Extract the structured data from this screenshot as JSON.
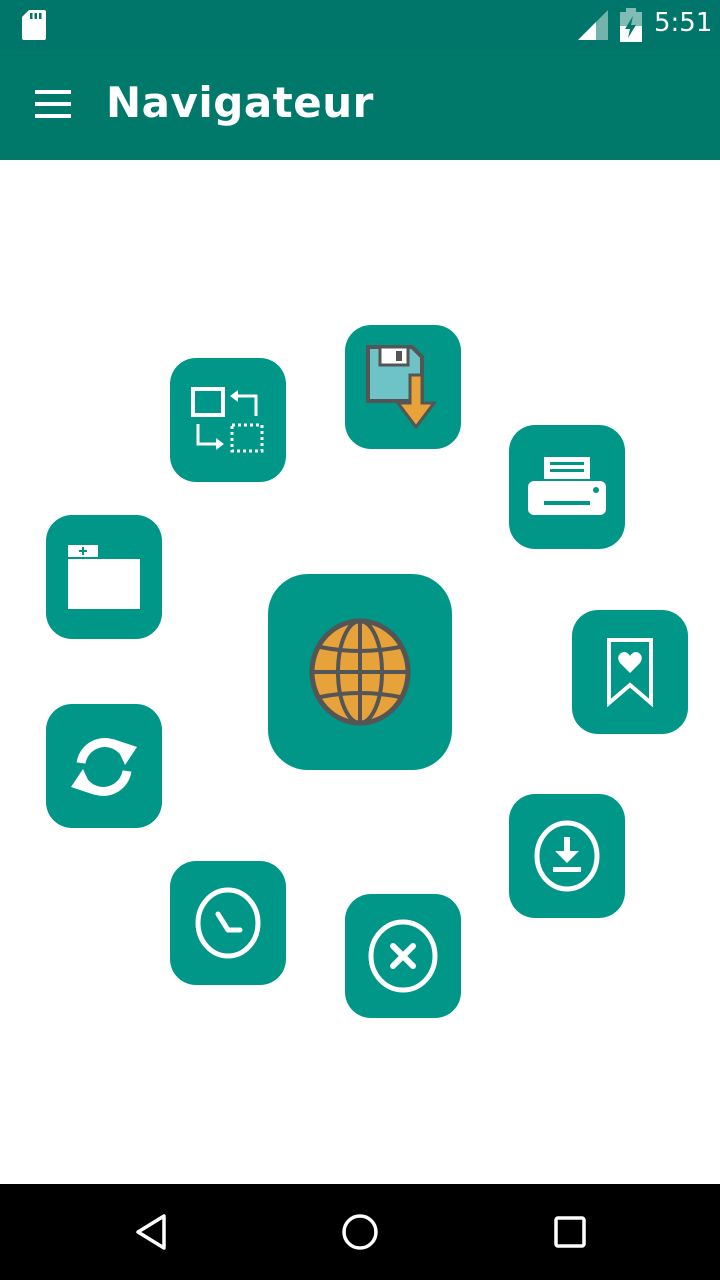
{
  "status_bar": {
    "time": "5:51",
    "icons": [
      "sd-card-icon",
      "signal-icon",
      "battery-icon"
    ]
  },
  "app_bar": {
    "title": "Navigateur",
    "menu_icon": "hamburger-menu-icon"
  },
  "center_button": {
    "icon": "globe-icon"
  },
  "action_tiles": [
    {
      "icon": "save-page-icon"
    },
    {
      "icon": "print-icon"
    },
    {
      "icon": "bookmark-icon"
    },
    {
      "icon": "download-icon"
    },
    {
      "icon": "close-icon"
    },
    {
      "icon": "history-icon"
    },
    {
      "icon": "refresh-icon"
    },
    {
      "icon": "new-tab-icon"
    },
    {
      "icon": "switch-tabs-icon"
    }
  ],
  "colors": {
    "status_bar": "#00766a",
    "app_bar": "#00796b",
    "tile": "#009688",
    "globe": "#e8a23a",
    "save_icon_fill": "#6ec3c6",
    "nav_bar": "#000000"
  },
  "nav_bar": {
    "icons": [
      "back-icon",
      "home-icon",
      "recents-icon"
    ]
  }
}
